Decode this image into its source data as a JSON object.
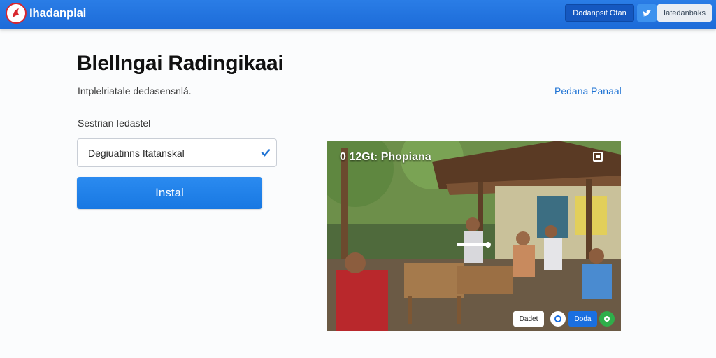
{
  "header": {
    "brand": "Ihadanplai",
    "primary_button": "Dodanpsit Otan",
    "secondary_button": "Iatedanbaks"
  },
  "main": {
    "title": "Blellngai Radingikaai",
    "subtitle": "Intplelriatale dedasensnlá.",
    "side_link": "Pedana Panaal",
    "field_label": "Sestrian Iedastel",
    "select_value": "Degiuatinns Itatanskal",
    "install_button": "Instal"
  },
  "video": {
    "overlay_title": "0  12Gt: Phopiana",
    "text_button": "Dadet",
    "blue_button": "Doda"
  },
  "colors": {
    "topbar": "#1c6bd8",
    "accent": "#1878e2",
    "link": "#1f73d4"
  },
  "icons": [
    "logo-icon",
    "twitter-icon",
    "check-icon",
    "corner-icon",
    "play-icon",
    "share-icon",
    "chat-icon"
  ]
}
